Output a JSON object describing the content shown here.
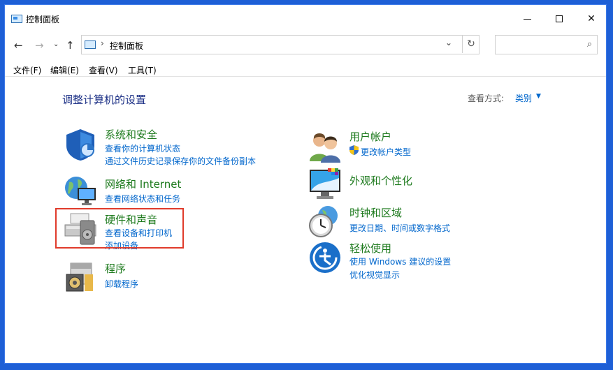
{
  "window": {
    "title": "控制面板"
  },
  "address": {
    "path": "控制面板"
  },
  "search": {
    "placeholder": ""
  },
  "menu": [
    "文件(F)",
    "编辑(E)",
    "查看(V)",
    "工具(T)"
  ],
  "page": {
    "heading": "调整计算机的设置",
    "view_by_label": "查看方式:",
    "view_by_value": "类别"
  },
  "categories": {
    "security": {
      "title": "系统和安全",
      "links": [
        "查看你的计算机状态",
        "通过文件历史记录保存你的文件备份副本"
      ]
    },
    "network": {
      "title": "网络和 Internet",
      "links": [
        "查看网络状态和任务"
      ]
    },
    "hardware": {
      "title": "硬件和声音",
      "links": [
        "查看设备和打印机",
        "添加设备"
      ]
    },
    "programs": {
      "title": "程序",
      "links": [
        "卸载程序"
      ]
    },
    "users": {
      "title": "用户帐户",
      "links": [
        "更改帐户类型"
      ]
    },
    "appearance": {
      "title": "外观和个性化",
      "links": []
    },
    "clock": {
      "title": "时钟和区域",
      "links": [
        "更改日期、时间或数字格式"
      ]
    },
    "ease": {
      "title": "轻松使用",
      "links": [
        "使用 Windows 建议的设置",
        "优化视觉显示"
      ]
    }
  },
  "colors": {
    "accent": "#0066cc",
    "category_title": "#1d7a1d",
    "heading": "#1e3287",
    "highlight": "#e03b2b"
  }
}
